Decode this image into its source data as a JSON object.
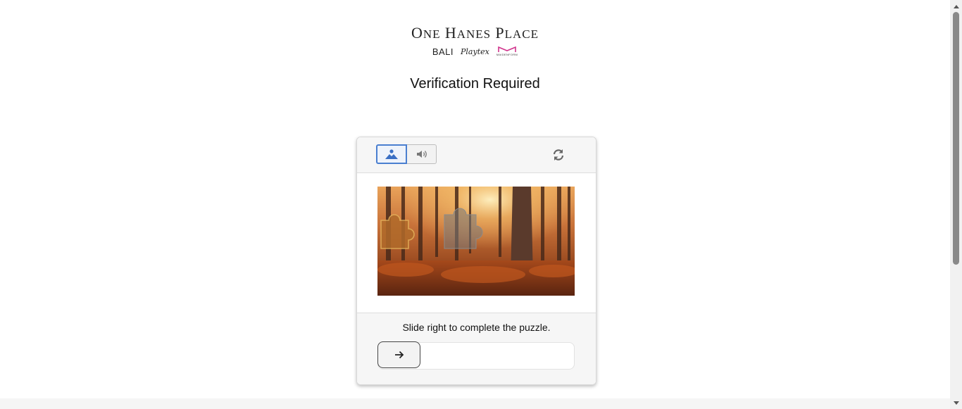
{
  "logo": {
    "main": [
      "One",
      "Hanes",
      "Place"
    ],
    "brands": [
      "BALI",
      "Playtex",
      "MAIDENFORM"
    ],
    "accent_color": "#d0338c"
  },
  "page": {
    "title": "Verification Required"
  },
  "captcha": {
    "modes": [
      {
        "name": "image-mode",
        "icon": "image-icon",
        "active": true
      },
      {
        "name": "audio-mode",
        "icon": "speaker-icon",
        "active": false
      }
    ],
    "refresh_icon": "refresh-icon",
    "instruction": "Slide right to complete the puzzle.",
    "slider_icon": "arrow-right-icon",
    "slider_progress": 0,
    "accent_color": "#4a7fd0"
  }
}
